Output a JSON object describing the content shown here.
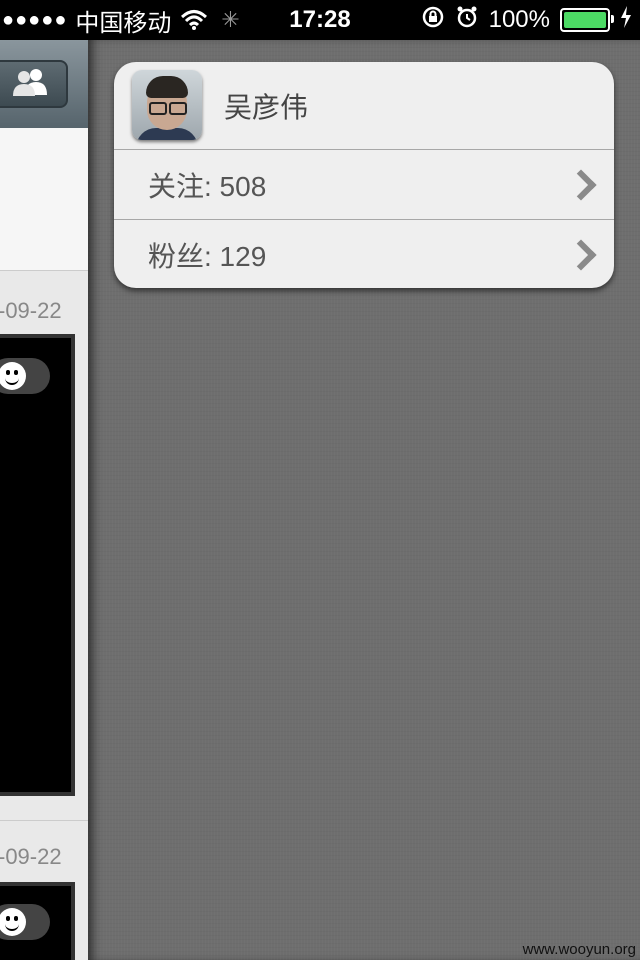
{
  "status_bar": {
    "signal": "●●●●●",
    "carrier": "中国移动",
    "time": "17:28",
    "battery": "100%",
    "battery_color": "#4cd964"
  },
  "left_panel": {
    "date_1": "-09-22",
    "date_2": "-09-22",
    "header_icon": "users-icon"
  },
  "profile_card": {
    "name": "吴彦伟",
    "follow_text": "关注: 508",
    "fans_text": "粉丝: 129"
  },
  "watermark": "www.wooyun.org"
}
